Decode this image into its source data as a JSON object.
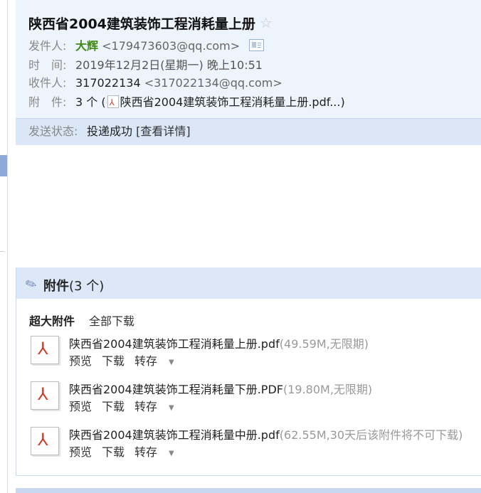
{
  "mail": {
    "subject": "陕西省2004建筑装饰工程消耗量上册",
    "sender_label": "发件人:",
    "sender_name": "大辉",
    "sender_email": "<179473603@qq.com>",
    "time_label": "时　间:",
    "time_value": "2019年12月2日(星期一) 晚上10:51",
    "receiver_label": "收件人:",
    "receiver_name": "317022134",
    "receiver_email": "<317022134@qq.com>",
    "attachment_label": "附　件:",
    "attachment_count": "3 个 (",
    "attachment_name": "陕西省2004建筑装饰工程消耗量上册.pdf...)",
    "status_label": "发送状态:",
    "status_value": "投递成功",
    "status_link": "[查看详情]"
  },
  "attachments": {
    "header_label": "附件",
    "header_count": "(3 个)",
    "super_label": "超大附件",
    "download_all": "全部下载",
    "preview_label": "预览",
    "download_label": "下载",
    "save_label": "转存",
    "files": [
      {
        "name": "陕西省2004建筑装饰工程消耗量上册.pdf",
        "meta": "(49.59M,无限期)"
      },
      {
        "name": "陕西省2004建筑装饰工程消耗量下册.PDF",
        "meta": "(19.80M,无限期)"
      },
      {
        "name": "陕西省2004建筑装饰工程消耗量中册.pdf",
        "meta": "(62.55M,30天后该附件将不可下载)"
      }
    ]
  },
  "icons": {
    "star": "star-icon",
    "contact": "contact-card-icon",
    "pdf": "pdf-icon",
    "clip": "paperclip-icon",
    "dropdown": "chevron-down-icon"
  },
  "colors": {
    "sender_name": "#3c8a15",
    "header_bg": "#eef4fc",
    "status_bg": "#dbe6f7",
    "attach_head_bg": "#dce8f8",
    "pdf_red": "#d13b2c"
  }
}
